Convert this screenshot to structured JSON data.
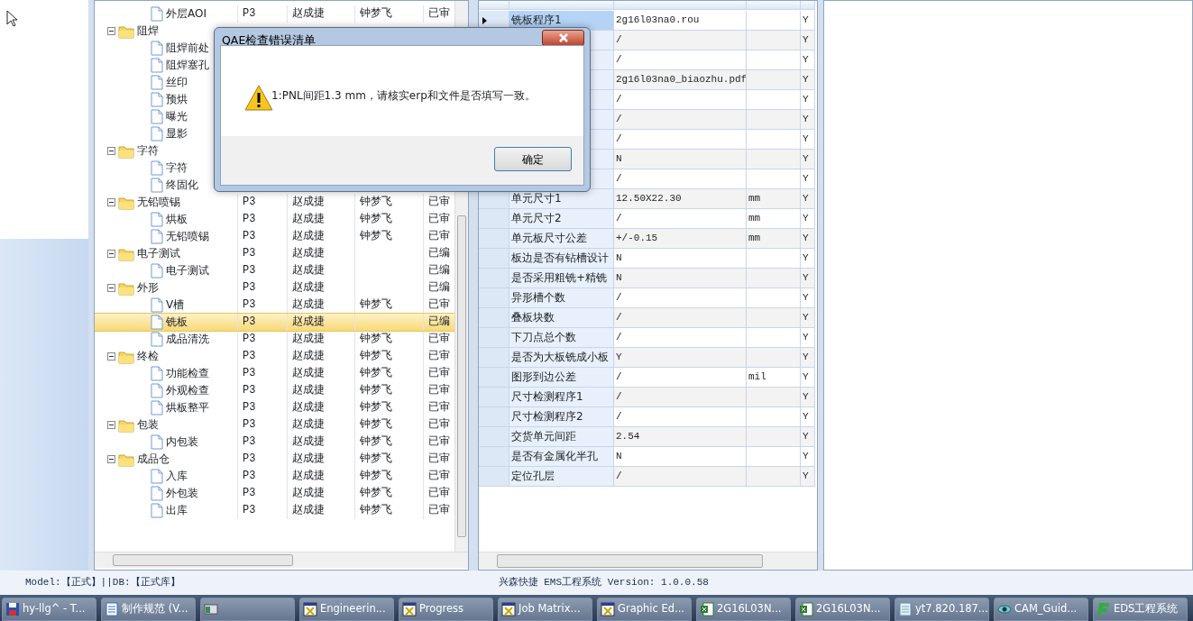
{
  "tree_panel": {
    "continued_children": [
      {
        "label": "外层AOI",
        "selected": false,
        "cells": {
          "tier": "P3",
          "maker": "赵成捷",
          "checker": "钟梦飞",
          "status": "已审"
        }
      }
    ],
    "folders": [
      {
        "label": "阻焊",
        "expanded": true,
        "selected": false,
        "children": [
          {
            "label": "阻焊前处",
            "selected": false
          },
          {
            "label": "阻焊塞孔",
            "selected": false
          },
          {
            "label": "丝印",
            "selected": false
          },
          {
            "label": "预烘",
            "selected": false
          },
          {
            "label": "曝光",
            "selected": false
          },
          {
            "label": "显影",
            "selected": false
          }
        ]
      },
      {
        "label": "字符",
        "expanded": true,
        "selected": false,
        "children": [
          {
            "label": "字符",
            "selected": false
          },
          {
            "label": "终固化",
            "selected": false
          }
        ]
      },
      {
        "label": "无铅喷锡",
        "expanded": true,
        "selected": false,
        "cells": {
          "tier": "P3",
          "maker": "赵成捷",
          "checker": "钟梦飞",
          "status": "已审"
        },
        "children": [
          {
            "label": "烘板",
            "selected": false,
            "cells": {
              "tier": "P3",
              "maker": "赵成捷",
              "checker": "钟梦飞",
              "status": "已审"
            }
          },
          {
            "label": "无铅喷锡",
            "selected": false,
            "cells": {
              "tier": "P3",
              "maker": "赵成捷",
              "checker": "钟梦飞",
              "status": "已审"
            }
          }
        ]
      },
      {
        "label": "电子测试",
        "expanded": true,
        "selected": false,
        "cells": {
          "tier": "P3",
          "maker": "赵成捷",
          "status": "已编"
        },
        "children": [
          {
            "label": "电子测试",
            "selected": false,
            "cells": {
              "tier": "P3",
              "maker": "赵成捷",
              "status": "已编"
            }
          }
        ]
      },
      {
        "label": "外形",
        "expanded": true,
        "selected": false,
        "cells": {
          "tier": "P3",
          "maker": "赵成捷",
          "status": "已编"
        },
        "children": [
          {
            "label": "V槽",
            "selected": false,
            "cells": {
              "tier": "P3",
              "maker": "赵成捷",
              "checker": "钟梦飞",
              "status": "已审"
            }
          },
          {
            "label": "铣板",
            "selected": true,
            "cells": {
              "tier": "P3",
              "maker": "赵成捷",
              "status": "已编"
            }
          },
          {
            "label": "成品清洗",
            "selected": false,
            "cells": {
              "tier": "P3",
              "maker": "赵成捷",
              "checker": "钟梦飞",
              "status": "已审"
            }
          }
        ]
      },
      {
        "label": "终检",
        "expanded": true,
        "selected": false,
        "cells": {
          "tier": "P3",
          "maker": "赵成捷",
          "checker": "钟梦飞",
          "status": "已审"
        },
        "children": [
          {
            "label": "功能检查",
            "selected": false,
            "cells": {
              "tier": "P3",
              "maker": "赵成捷",
              "checker": "钟梦飞",
              "status": "已审"
            }
          },
          {
            "label": "外观检查",
            "selected": false,
            "cells": {
              "tier": "P3",
              "maker": "赵成捷",
              "checker": "钟梦飞",
              "status": "已审"
            }
          },
          {
            "label": "烘板整平",
            "selected": false,
            "cells": {
              "tier": "P3",
              "maker": "赵成捷",
              "checker": "钟梦飞",
              "status": "已审"
            }
          }
        ]
      },
      {
        "label": "包装",
        "expanded": true,
        "selected": false,
        "cells": {
          "tier": "P3",
          "maker": "赵成捷",
          "checker": "钟梦飞",
          "status": "已审"
        },
        "children": [
          {
            "label": "内包装",
            "selected": false,
            "cells": {
              "tier": "P3",
              "maker": "赵成捷",
              "checker": "钟梦飞",
              "status": "已审"
            }
          }
        ]
      },
      {
        "label": "成品仓",
        "expanded": true,
        "selected": false,
        "cells": {
          "tier": "P3",
          "maker": "赵成捷",
          "checker": "钟梦飞",
          "status": "已审"
        },
        "children": [
          {
            "label": "入库",
            "selected": false,
            "cells": {
              "tier": "P3",
              "maker": "赵成捷",
              "checker": "钟梦飞",
              "status": "已审"
            }
          },
          {
            "label": "外包装",
            "selected": false,
            "cells": {
              "tier": "P3",
              "maker": "赵成捷",
              "checker": "钟梦飞",
              "status": "已审"
            }
          },
          {
            "label": "出库",
            "selected": false,
            "cells": {
              "tier": "P3",
              "maker": "赵成捷",
              "checker": "钟梦飞",
              "status": "已审"
            }
          }
        ]
      }
    ]
  },
  "properties_grid": {
    "rows": [
      {
        "name": "铣板程序1",
        "value": "2g16l03na0.rou",
        "flag": "Y",
        "selected": true
      },
      {
        "value": "/",
        "flag": "Y",
        "selected": false
      },
      {
        "value": "/",
        "flag": "Y",
        "selected": false
      },
      {
        "value": "2g16l03na0_biaozhu.pdf",
        "flag": "Y",
        "selected": false
      },
      {
        "value": "/",
        "flag": "Y",
        "selected": false
      },
      {
        "value": "/",
        "flag": "Y",
        "selected": false
      },
      {
        "value": "/",
        "flag": "Y",
        "selected": false
      },
      {
        "value": "N",
        "flag": "Y",
        "selected": false
      },
      {
        "value": "/",
        "flag": "Y",
        "selected": false
      },
      {
        "name": "单元尺寸1",
        "value": "12.50X22.30",
        "unit": "mm",
        "flag": "Y",
        "selected": false
      },
      {
        "name": "单元尺寸2",
        "value": "/",
        "unit": "mm",
        "flag": "Y",
        "selected": false
      },
      {
        "name": "单元板尺寸公差",
        "value": "+/-0.15",
        "unit": "mm",
        "flag": "Y",
        "selected": false
      },
      {
        "name": "板边是否有钻槽设计",
        "value": "N",
        "flag": "Y",
        "selected": false
      },
      {
        "name": "是否采用粗铣+精铣",
        "value": "N",
        "flag": "Y",
        "selected": false
      },
      {
        "name": "异形槽个数",
        "value": "/",
        "flag": "Y",
        "selected": false
      },
      {
        "name": "叠板块数",
        "value": "/",
        "flag": "Y",
        "selected": false
      },
      {
        "name": "下刀点总个数",
        "value": "/",
        "flag": "Y",
        "selected": false
      },
      {
        "name": "是否为大板铣成小板",
        "value": "Y",
        "flag": "Y",
        "selected": false
      },
      {
        "name": "图形到边公差",
        "value": "/",
        "unit": "mil",
        "flag": "Y",
        "selected": false
      },
      {
        "name": "尺寸检测程序1",
        "value": "/",
        "flag": "Y",
        "selected": false
      },
      {
        "name": "尺寸检测程序2",
        "value": "/",
        "flag": "Y",
        "selected": false
      },
      {
        "name": "交货单元间距",
        "value": "2.54",
        "flag": "Y",
        "selected": false
      },
      {
        "name": "是否有金属化半孔",
        "value": "N",
        "flag": "Y",
        "selected": false
      },
      {
        "name": "定位孔层",
        "value": "/",
        "flag": "Y",
        "selected": false
      }
    ]
  },
  "dialog": {
    "title": "QAE检查错误清单",
    "message": "1:PNL间距1.3 mm，请核实erp和文件是否填写一致。",
    "buttons": [
      "确定"
    ]
  },
  "status_bar": {
    "mode": "Model:【正式】||DB:【正式库】",
    "app": "兴森快捷 EMS工程系统 Version: 1.0.0.58"
  },
  "taskbar": {
    "buttons": [
      {
        "label": "hy-llg^ - T...",
        "kind": "disk"
      },
      {
        "label": "制作规范 (V...",
        "kind": "doc"
      },
      {
        "kind": "window"
      },
      {
        "label": "Engineerin...",
        "kind": "app"
      },
      {
        "label": "Progress",
        "kind": "app"
      },
      {
        "label": "Job Matrix...",
        "kind": "app"
      },
      {
        "label": "Graphic Ed...",
        "kind": "app"
      },
      {
        "label": "2G16L03N...",
        "kind": "sheet"
      },
      {
        "label": "2G16L03N...",
        "kind": "sheet"
      },
      {
        "label": "yt7.820.187...",
        "kind": "note"
      },
      {
        "label": "CAM_Guid...",
        "kind": "eye"
      },
      {
        "label": "EDS工程系统",
        "kind": "eds"
      }
    ]
  }
}
